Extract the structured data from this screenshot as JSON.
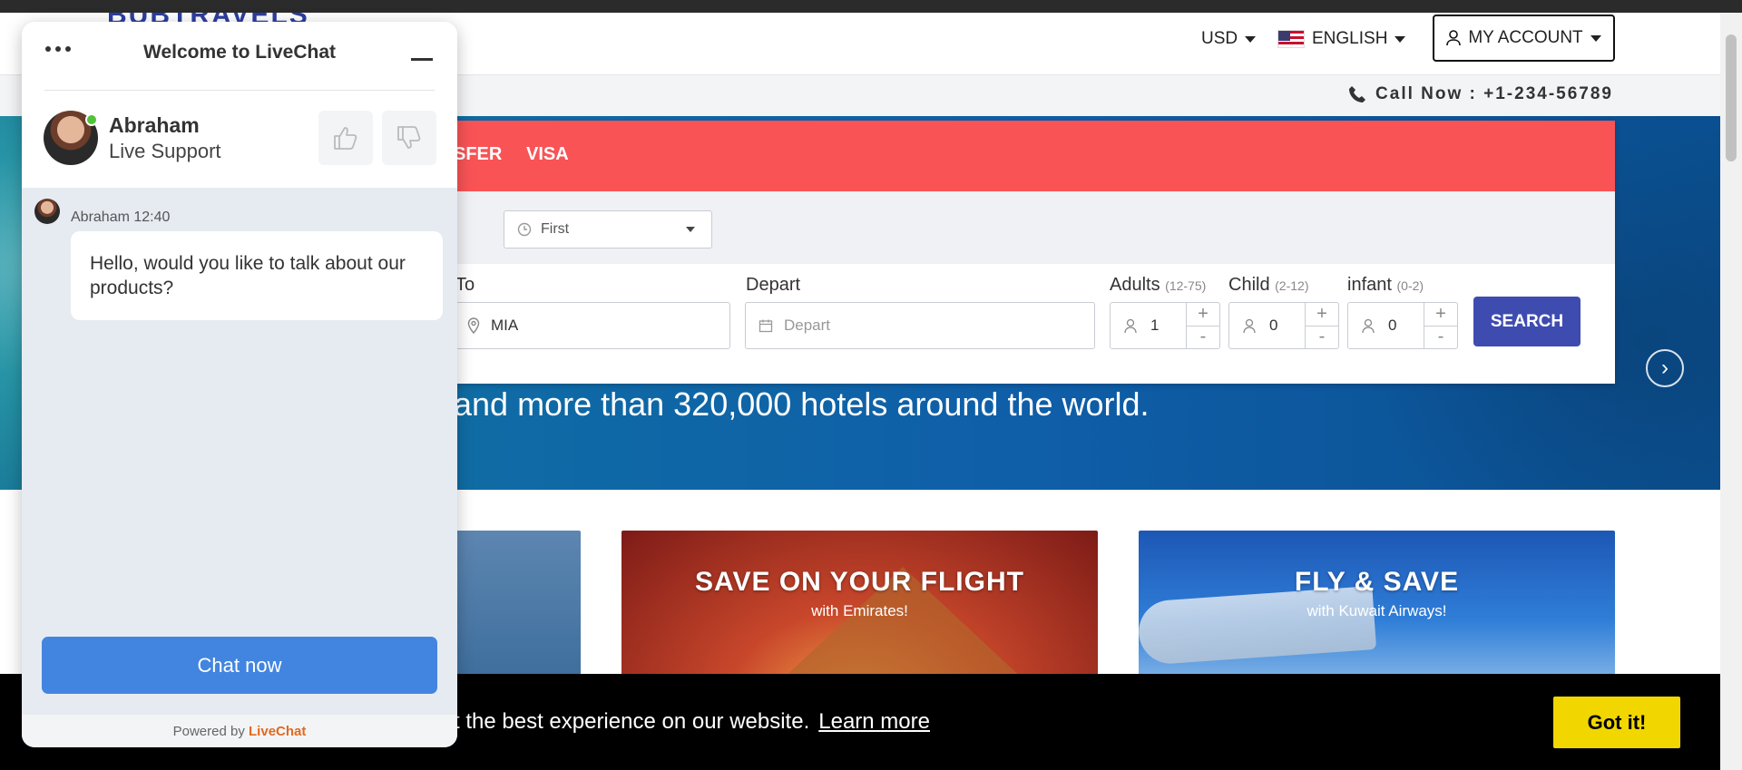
{
  "header": {
    "logo_text": "BUBTRAVELS",
    "currency": "USD",
    "language": "ENGLISH",
    "account_label": "MY ACCOUNT",
    "call_label": "Call Now : +1-234-56789"
  },
  "search": {
    "tabs": [
      "SFER",
      "VISA"
    ],
    "cabin_class": "First",
    "to_label": "To",
    "to_value": "MIA",
    "depart_label": "Depart",
    "depart_placeholder": "Depart",
    "adults_label": "Adults",
    "adults_range": "(12-75)",
    "adults_value": "1",
    "child_label": "Child",
    "child_range": "(2-12)",
    "child_value": "0",
    "infant_label": "infant",
    "infant_range": "(0-2)",
    "infant_value": "0",
    "plus": "+",
    "minus": "-",
    "search_label": "SEARCH"
  },
  "hero": {
    "tagline": "and more than 320,000 hotels around the world."
  },
  "promos": [
    {
      "title": "",
      "subtitle": ""
    },
    {
      "title": "SAVE ON YOUR FLIGHT",
      "subtitle": "with Emirates!"
    },
    {
      "title": "FLY & SAVE",
      "subtitle": "with Kuwait Airways!"
    }
  ],
  "cookie": {
    "text": "t the best experience on our website.",
    "learn_more": "Learn more",
    "button": "Got it!"
  },
  "livechat": {
    "title": "Welcome to LiveChat",
    "agent_name": "Abraham",
    "agent_role": "Live Support",
    "message_meta": "Abraham 12:40",
    "message": "Hello, would you like to talk about our products?",
    "chat_button": "Chat now",
    "powered_prefix": "Powered by",
    "powered_brand": "LiveChat"
  },
  "colors": {
    "accent_red": "#f95356",
    "search_button": "#3e4cb0",
    "chat_button": "#4285e0",
    "cookie_button": "#f1d600"
  }
}
